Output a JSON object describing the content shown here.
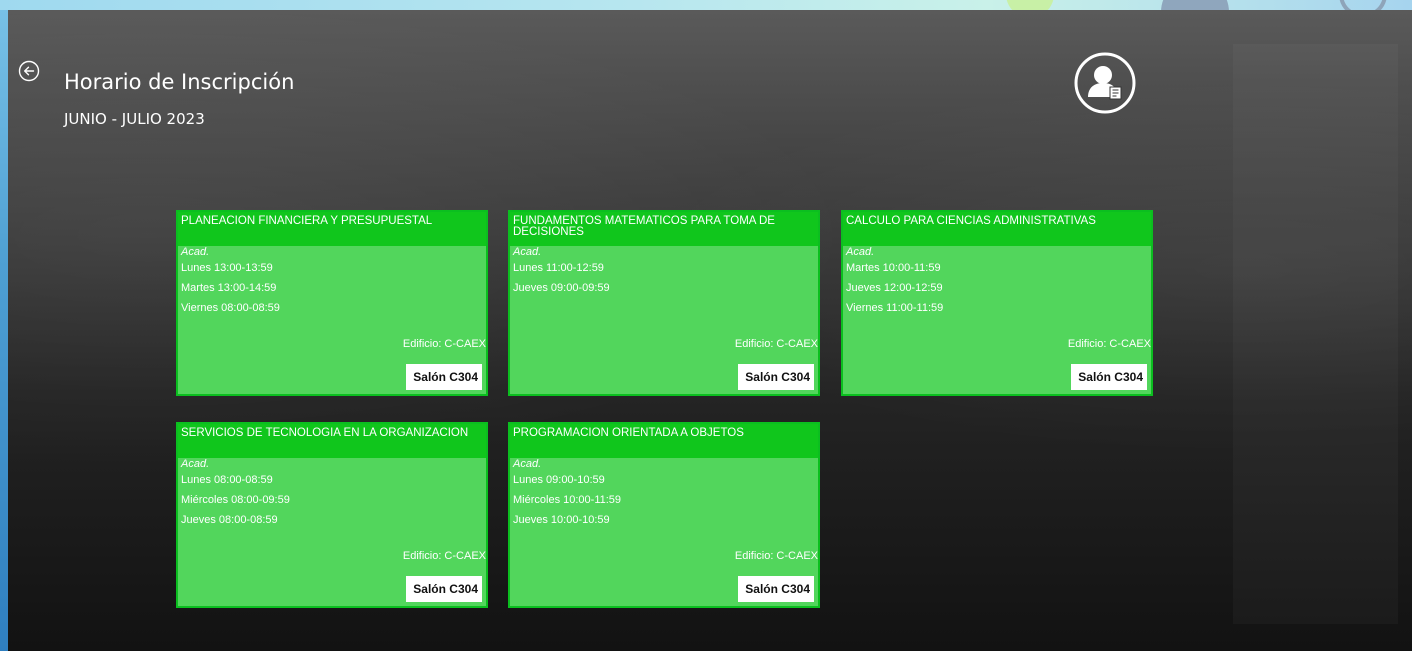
{
  "header": {
    "title": "Horario de Inscripción",
    "period": "JUNIO - JULIO 2023",
    "back_icon": "back-arrow-icon",
    "user_icon": "user-profile-icon"
  },
  "colors": {
    "card_bg": "#52d65c",
    "card_header": "#10c61c",
    "card_border": "#0bbf1f",
    "room_bg": "#ffffff"
  },
  "courses": [
    {
      "name": "PLANEACION FINANCIERA Y PRESUPUESTAL",
      "type": "Acad.",
      "schedule": [
        "Lunes 13:00-13:59",
        "Martes 13:00-14:59",
        "Viernes 08:00-08:59"
      ],
      "building": "Edificio: C-CAEX",
      "room": "Salón C304"
    },
    {
      "name": "FUNDAMENTOS MATEMATICOS PARA TOMA DE DECISIONES",
      "type": "Acad.",
      "schedule": [
        "Lunes 11:00-12:59",
        "Jueves 09:00-09:59"
      ],
      "building": "Edificio: C-CAEX",
      "room": "Salón C304"
    },
    {
      "name": "CALCULO PARA CIENCIAS ADMINISTRATIVAS",
      "type": "Acad.",
      "schedule": [
        "Martes 10:00-11:59",
        "Jueves 12:00-12:59",
        "Viernes 11:00-11:59"
      ],
      "building": "Edificio: C-CAEX",
      "room": "Salón C304"
    },
    {
      "name": "SERVICIOS DE TECNOLOGIA EN LA ORGANIZACION",
      "type": "Acad.",
      "schedule": [
        "Lunes 08:00-08:59",
        "Miércoles 08:00-09:59",
        "Jueves 08:00-08:59"
      ],
      "building": "Edificio: C-CAEX",
      "room": "Salón C304"
    },
    {
      "name": "PROGRAMACION ORIENTADA A OBJETOS",
      "type": "Acad.",
      "schedule": [
        "Lunes 09:00-10:59",
        "Miércoles 10:00-11:59",
        "Jueves 10:00-10:59"
      ],
      "building": "Edificio: C-CAEX",
      "room": "Salón C304"
    }
  ]
}
